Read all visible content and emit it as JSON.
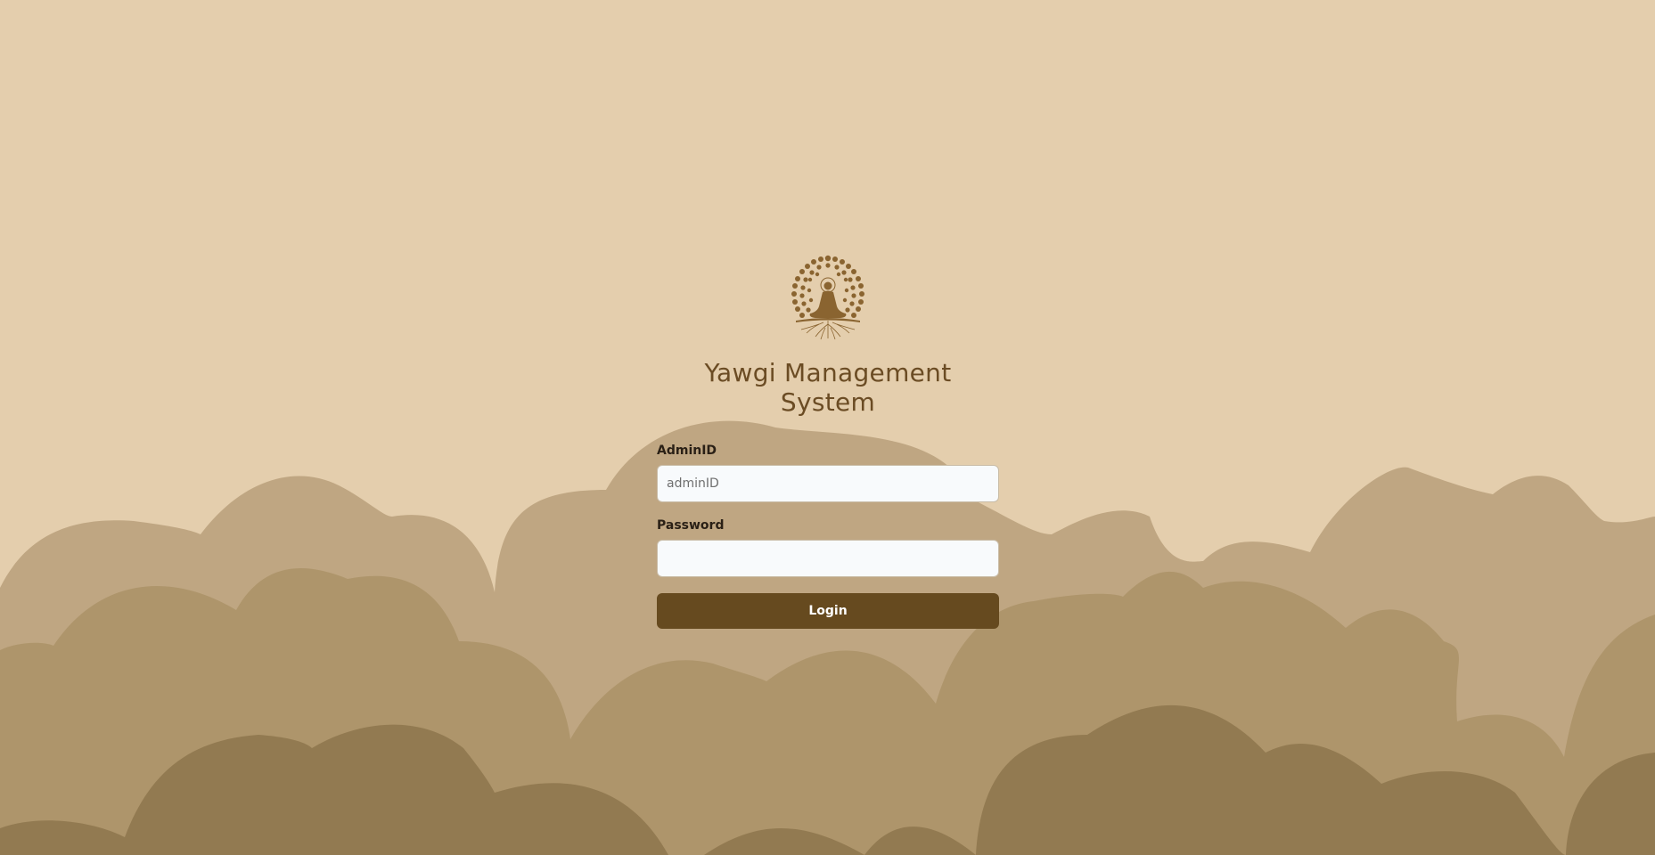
{
  "app": {
    "title": "Yawgi Management System"
  },
  "logo": {
    "icon": "meditation-tree-icon",
    "color": "#8a6430"
  },
  "form": {
    "admin_id": {
      "label": "AdminID",
      "placeholder": "adminID",
      "value": ""
    },
    "password": {
      "label": "Password",
      "placeholder": "",
      "value": ""
    },
    "login_label": "Login"
  },
  "colors": {
    "background": "#e4cead",
    "hill_light": "#bfa682",
    "hill_mid": "#ae956b",
    "hill_dark": "#927a51",
    "accent": "#664a1f",
    "title": "#6b4c24"
  }
}
